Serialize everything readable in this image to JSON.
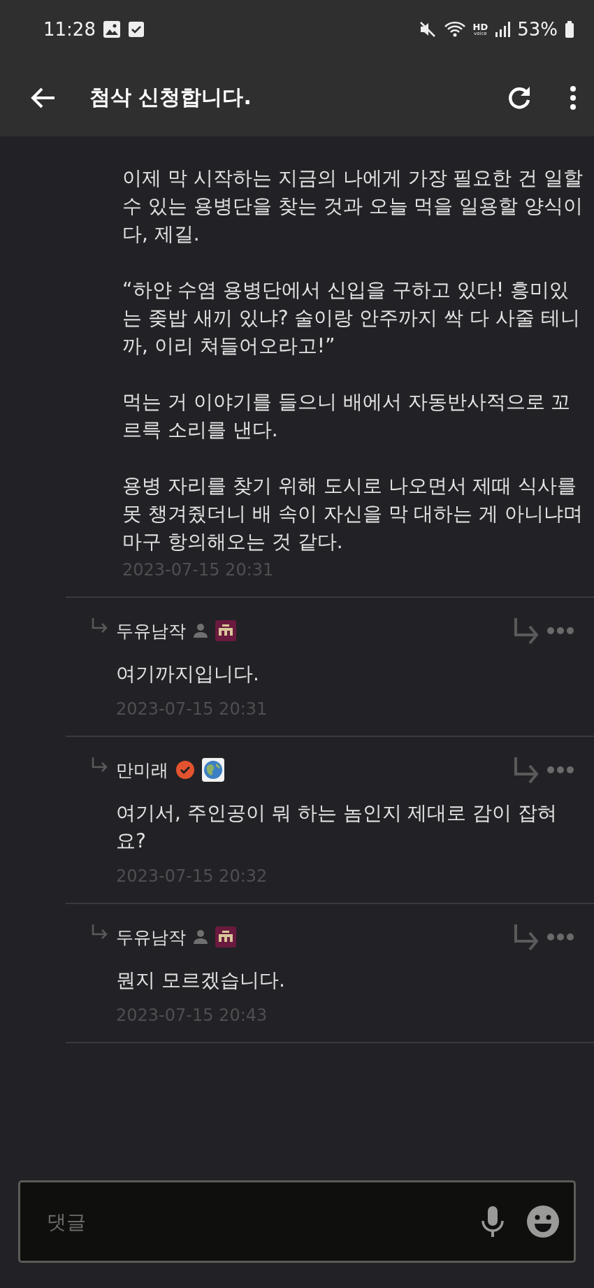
{
  "status_bar": {
    "time": "11:28",
    "hd_label": "HD",
    "voice_label": "voice",
    "battery": "53%"
  },
  "header": {
    "title": "첨삭 신청합니다."
  },
  "post": {
    "paragraphs": [
      "이제 막 시작하는 지금의 나에게 가장 필요한 건 일할 수 있는 용병단을 찾는 것과 오늘 먹을 일용할 양식이다, 제길.",
      "“하얀 수염 용병단에서 신입을 구하고 있다! 흥미있는 좆밥 새끼 있냐? 술이랑 안주까지 싹 다 사줄 테니까, 이리 쳐들어오라고!”",
      "먹는 거 이야기를 들으니 배에서 자동반사적으로 꼬르륵 소리를 낸다.",
      "용병 자리를 찾기 위해 도시로 나오면서 제때 식사를 못 챙겨줬더니 배 속이 자신을 막 대하는 게 아니냐며 마구 항의해오는 것 같다."
    ],
    "date": "2023-07-15 20:31"
  },
  "replies": [
    {
      "author": "두유남작",
      "kind": "member",
      "text": "여기까지입니다.",
      "date": "2023-07-15 20:31"
    },
    {
      "author": "만미래",
      "kind": "verified",
      "text": "여기서, 주인공이 뭐 하는 놈인지 제대로 감이 잡혀요?",
      "date": "2023-07-15 20:32"
    },
    {
      "author": "두유남작",
      "kind": "member",
      "text": "뭔지 모르겠습니다.",
      "date": "2023-07-15 20:43"
    }
  ],
  "comment_input": {
    "placeholder": "댓글"
  }
}
